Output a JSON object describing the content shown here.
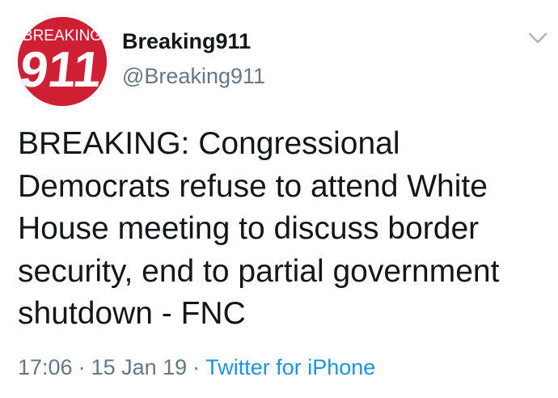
{
  "tweet": {
    "avatar_text_top": "BREAKING",
    "avatar_text_main": "911",
    "display_name": "Breaking911",
    "handle": "@Breaking911",
    "text": "BREAKING: Congressional Democrats refuse to attend White House meeting to discuss border security, end to partial government shutdown - FNC",
    "time": "17:06",
    "date": "15 Jan 19",
    "separator": "·",
    "source": "Twitter for iPhone"
  },
  "icons": {
    "caret": "chevron-down-icon"
  },
  "colors": {
    "avatar_bg": "#cf1f33",
    "text": "#14171a",
    "muted": "#657786",
    "link": "#1b95e0"
  }
}
